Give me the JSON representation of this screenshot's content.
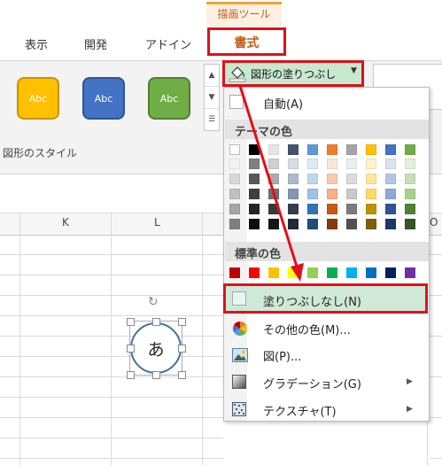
{
  "ribbon": {
    "context_group": "描画ツール",
    "tabs": [
      "表示",
      "開発",
      "アドイン"
    ],
    "active_tab": "書式",
    "shape_styles": [
      {
        "label": "Abc",
        "color": "#ffc000"
      },
      {
        "label": "Abc",
        "color": "#4472c4"
      },
      {
        "label": "Abc",
        "color": "#70ad47"
      }
    ],
    "group_label": "図形のスタイル",
    "fill_button": {
      "label": "図形の塗りつぶし",
      "color": "#c6e9d0"
    }
  },
  "sheet": {
    "columns": [
      "K",
      "L",
      "O"
    ],
    "shape_text": "あ"
  },
  "fill_menu": {
    "auto_label": "自動(A)",
    "theme_header": "テーマの色",
    "theme_colors": [
      [
        "#ffffff",
        "#000000",
        "#e7e6e6",
        "#44546a",
        "#5b9bd5",
        "#ed7d31",
        "#a5a5a5",
        "#ffc000",
        "#4472c4",
        "#70ad47"
      ],
      [
        "#f2f2f2",
        "#7f7f7f",
        "#d0cece",
        "#d6dce4",
        "#deebf6",
        "#fbe5d5",
        "#ededed",
        "#fff2cc",
        "#d9e2f3",
        "#e2efd9"
      ],
      [
        "#d8d8d8",
        "#595959",
        "#aeaaaa",
        "#adb9ca",
        "#bdd7ee",
        "#f7cbac",
        "#dbdbdb",
        "#fee599",
        "#b4c6e7",
        "#c5e0b3"
      ],
      [
        "#bfbfbf",
        "#3f3f3f",
        "#757070",
        "#8496b0",
        "#9dc3e6",
        "#f4b183",
        "#c9c9c9",
        "#ffd965",
        "#8eaadb",
        "#a8d08d"
      ],
      [
        "#a5a5a5",
        "#262626",
        "#3a3838",
        "#323f4f",
        "#2e75b5",
        "#c55a11",
        "#7b7b7b",
        "#bf9000",
        "#2f5496",
        "#538135"
      ],
      [
        "#7f7f7f",
        "#0c0c0c",
        "#171616",
        "#222a35",
        "#1e4e79",
        "#833c0b",
        "#525252",
        "#7f6000",
        "#1f3864",
        "#375623"
      ]
    ],
    "standard_header": "標準の色",
    "standard_colors": [
      "#c00000",
      "#ff0000",
      "#ffc000",
      "#ffff00",
      "#92d050",
      "#00b050",
      "#00b0f0",
      "#0070c0",
      "#002060",
      "#7030a0"
    ],
    "no_fill_label": "塗りつぶしなし(N)",
    "other_colors_label": "その他の色(M)...",
    "picture_label": "図(P)...",
    "gradient_label": "グラデーション(G)",
    "texture_label": "テクスチャ(T)"
  },
  "colors": {
    "highlight": "#e0101a",
    "accent": "#c55a11"
  }
}
